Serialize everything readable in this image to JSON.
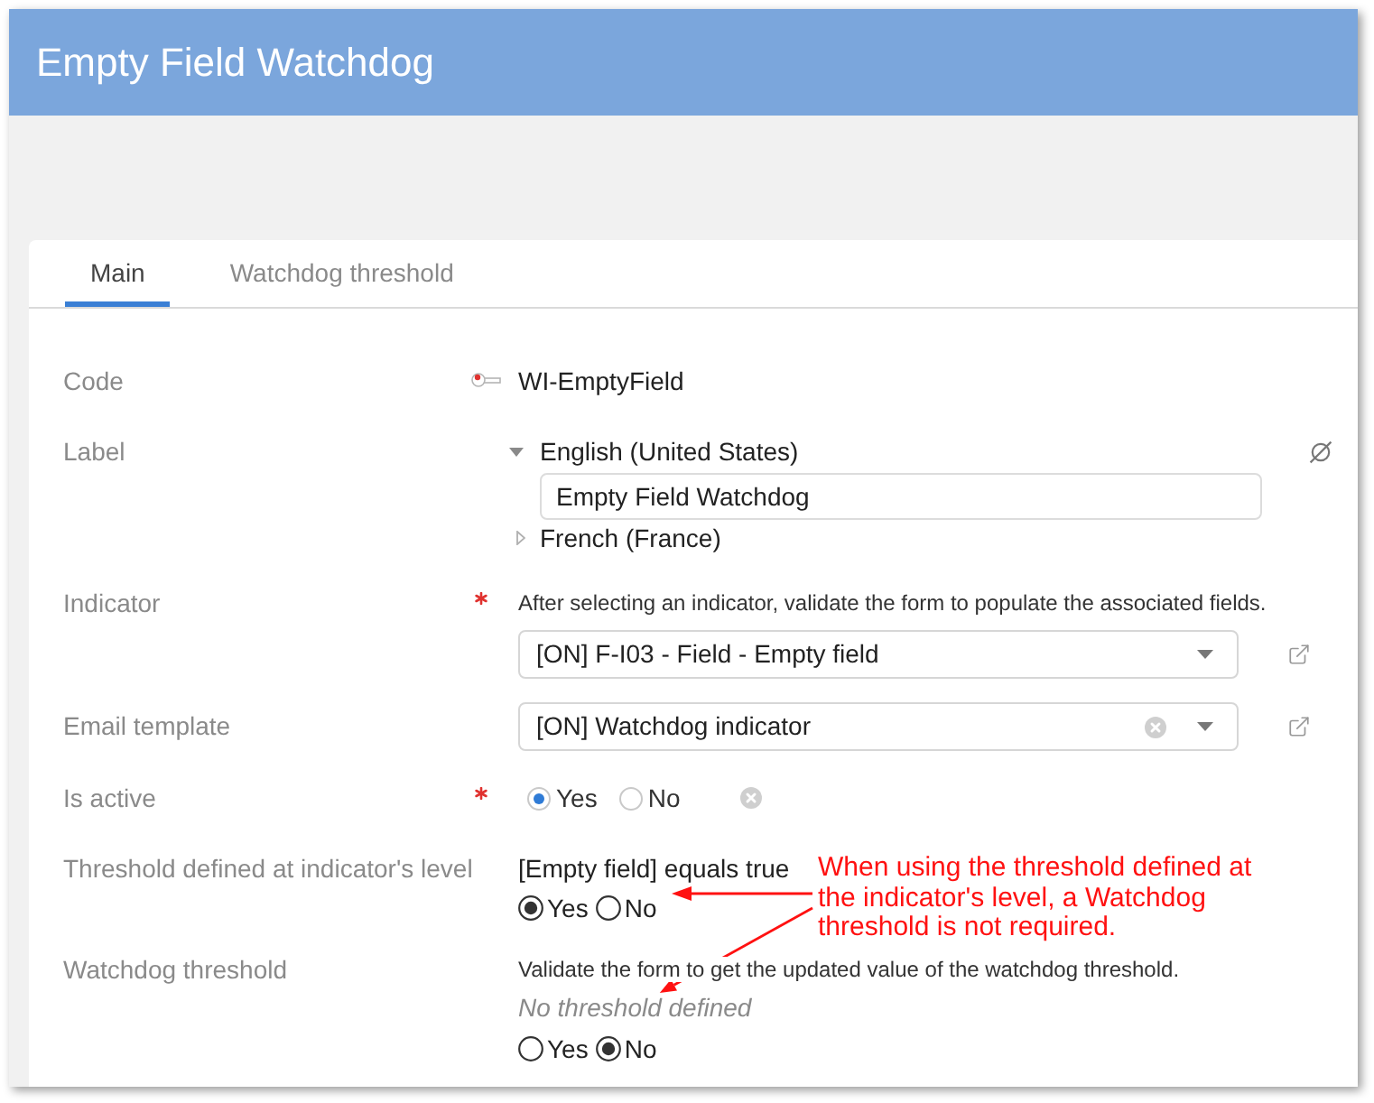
{
  "window": {
    "title": "Empty Field Watchdog"
  },
  "tabs": [
    {
      "label": "Main",
      "selected": true
    },
    {
      "label": "Watchdog threshold",
      "selected": false
    }
  ],
  "fields": [
    {
      "kind": "code",
      "label": "Code",
      "required": false,
      "value": "WI-EmptyField"
    },
    {
      "kind": "translations",
      "label": "Label",
      "required": false,
      "languages": [
        {
          "name": "English (United States)",
          "expanded": true,
          "value": "Empty Field Watchdog"
        },
        {
          "name": "French (France)",
          "expanded": false
        }
      ]
    },
    {
      "kind": "select",
      "label": "Indicator",
      "required": true,
      "help": "After selecting an indicator, validate the form to populate the associated fields.",
      "value": "[ON] F-I03 - Field - Empty field",
      "clearable": false
    },
    {
      "kind": "select",
      "label": "Email template",
      "required": false,
      "value": "[ON] Watchdog indicator",
      "clearable": true
    },
    {
      "kind": "radio",
      "label": "Is active",
      "required": true,
      "clearable": true,
      "options": [
        {
          "label": "Yes",
          "selected": true
        },
        {
          "label": "No",
          "selected": false
        }
      ]
    },
    {
      "kind": "plainradio",
      "label": "Threshold defined at indicator's level",
      "required": false,
      "condition": "[Empty field] equals true",
      "options": [
        {
          "label": "Yes",
          "selected": true
        },
        {
          "label": "No",
          "selected": false
        }
      ]
    },
    {
      "kind": "plainradio",
      "label": "Watchdog threshold",
      "required": false,
      "help": "Validate the form to get the updated value of the watchdog threshold.",
      "empty_text": "No threshold defined",
      "options": [
        {
          "label": "Yes",
          "selected": false
        },
        {
          "label": "No",
          "selected": true
        }
      ]
    }
  ],
  "annotation": {
    "lines": [
      "When using the threshold defined at",
      "the indicator's level, a Watchdog",
      "threshold is not required."
    ]
  }
}
